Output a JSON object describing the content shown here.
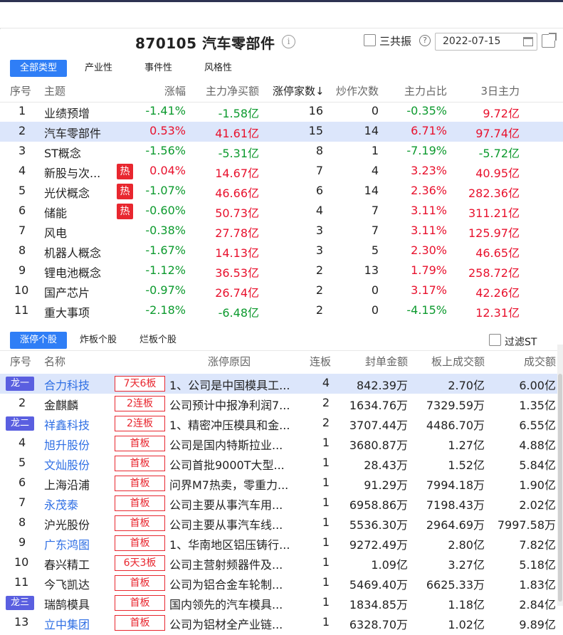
{
  "header": {
    "title": "870105 汽车零部件",
    "sangong_label": "三共振",
    "date": "2022-07-15"
  },
  "concept_tabs": [
    "全部类型",
    "产业性",
    "事件性",
    "风格性"
  ],
  "concept_columns": [
    "序号",
    "主题",
    "涨幅",
    "主力净买额",
    "涨停家数↓",
    "炒作次数",
    "主力占比",
    "3日主力"
  ],
  "concepts": [
    {
      "no": "1",
      "name": "业绩预增",
      "hot": false,
      "chg": "-1.41%",
      "net": "-1.58亿",
      "limit": "16",
      "times": "0",
      "ratio": "-0.35%",
      "d3": "9.72亿"
    },
    {
      "no": "2",
      "name": "汽车零部件",
      "hot": false,
      "chg": "0.53%",
      "net": "41.61亿",
      "limit": "15",
      "times": "14",
      "ratio": "6.71%",
      "d3": "97.74亿"
    },
    {
      "no": "3",
      "name": "ST概念",
      "hot": false,
      "chg": "-1.56%",
      "net": "-5.31亿",
      "limit": "8",
      "times": "1",
      "ratio": "-7.19%",
      "d3": "-5.72亿"
    },
    {
      "no": "4",
      "name": "新股与次...",
      "hot": true,
      "chg": "0.04%",
      "net": "14.67亿",
      "limit": "7",
      "times": "4",
      "ratio": "3.23%",
      "d3": "40.95亿"
    },
    {
      "no": "5",
      "name": "光伏概念",
      "hot": true,
      "chg": "-1.07%",
      "net": "46.66亿",
      "limit": "6",
      "times": "14",
      "ratio": "2.36%",
      "d3": "282.36亿"
    },
    {
      "no": "6",
      "name": "储能",
      "hot": true,
      "chg": "-0.60%",
      "net": "50.73亿",
      "limit": "4",
      "times": "7",
      "ratio": "3.11%",
      "d3": "311.21亿"
    },
    {
      "no": "7",
      "name": "风电",
      "hot": false,
      "chg": "-0.38%",
      "net": "27.78亿",
      "limit": "3",
      "times": "7",
      "ratio": "3.11%",
      "d3": "125.97亿"
    },
    {
      "no": "8",
      "name": "机器人概念",
      "hot": false,
      "chg": "-1.67%",
      "net": "14.13亿",
      "limit": "3",
      "times": "5",
      "ratio": "2.30%",
      "d3": "46.65亿"
    },
    {
      "no": "9",
      "name": "锂电池概念",
      "hot": false,
      "chg": "-1.12%",
      "net": "36.53亿",
      "limit": "2",
      "times": "13",
      "ratio": "1.79%",
      "d3": "258.72亿"
    },
    {
      "no": "10",
      "name": "国产芯片",
      "hot": false,
      "chg": "-0.97%",
      "net": "26.74亿",
      "limit": "2",
      "times": "0",
      "ratio": "3.17%",
      "d3": "42.26亿"
    },
    {
      "no": "11",
      "name": "重大事项",
      "hot": false,
      "chg": "-2.18%",
      "net": "-6.48亿",
      "limit": "2",
      "times": "0",
      "ratio": "-4.15%",
      "d3": "12.31亿"
    }
  ],
  "hot_label": "热",
  "stock_tabs": [
    "涨停个股",
    "炸板个股",
    "烂板个股"
  ],
  "filter_label": "过滤ST",
  "stock_columns": [
    "序号",
    "名称",
    "涨停原因",
    "连板",
    "封单金额",
    "板上成交额",
    "成交额"
  ],
  "stocks": [
    {
      "no": "",
      "dragon": "龙一",
      "name": "合力科技",
      "link": true,
      "badge": "7天6板",
      "reason": "1、公司是中国模具工...",
      "lb": "4",
      "fd": "842.39万",
      "bs": "2.70亿",
      "cj": "6.00亿"
    },
    {
      "no": "2",
      "dragon": "",
      "name": "金麒麟",
      "link": false,
      "badge": "2连板",
      "reason": "公司预计中报净利润7...",
      "lb": "2",
      "fd": "1634.76万",
      "bs": "7329.59万",
      "cj": "1.35亿"
    },
    {
      "no": "",
      "dragon": "龙二",
      "name": "祥鑫科技",
      "link": true,
      "badge": "2连板",
      "reason": "1、精密冲压模具和金...",
      "lb": "2",
      "fd": "3707.44万",
      "bs": "4486.70万",
      "cj": "6.55亿"
    },
    {
      "no": "4",
      "dragon": "",
      "name": "旭升股份",
      "link": true,
      "badge": "首板",
      "reason": "公司是国内特斯拉业...",
      "lb": "1",
      "fd": "3680.87万",
      "bs": "1.27亿",
      "cj": "4.88亿"
    },
    {
      "no": "5",
      "dragon": "",
      "name": "文灿股份",
      "link": true,
      "badge": "首板",
      "reason": "公司首批9000T大型...",
      "lb": "1",
      "fd": "28.43万",
      "bs": "1.52亿",
      "cj": "5.84亿"
    },
    {
      "no": "6",
      "dragon": "",
      "name": "上海沿浦",
      "link": false,
      "badge": "首板",
      "reason": "问界M7热卖，零重力...",
      "lb": "1",
      "fd": "91.29万",
      "bs": "7994.18万",
      "cj": "1.90亿"
    },
    {
      "no": "7",
      "dragon": "",
      "name": "永茂泰",
      "link": true,
      "badge": "首板",
      "reason": "公司主要从事汽车用...",
      "lb": "1",
      "fd": "6958.86万",
      "bs": "7198.43万",
      "cj": "2.02亿"
    },
    {
      "no": "8",
      "dragon": "",
      "name": "沪光股份",
      "link": false,
      "badge": "首板",
      "reason": "公司主要从事汽车线...",
      "lb": "1",
      "fd": "5536.30万",
      "bs": "2964.69万",
      "cj": "7997.58万"
    },
    {
      "no": "9",
      "dragon": "",
      "name": "广东鸿图",
      "link": true,
      "badge": "首板",
      "reason": "1、华南地区铝压铸行...",
      "lb": "1",
      "fd": "9272.49万",
      "bs": "2.80亿",
      "cj": "7.82亿"
    },
    {
      "no": "10",
      "dragon": "",
      "name": "春兴精工",
      "link": false,
      "badge": "6天3板",
      "reason": "公司主营射频器件及...",
      "lb": "1",
      "fd": "1.09亿",
      "bs": "3.27亿",
      "cj": "5.18亿"
    },
    {
      "no": "11",
      "dragon": "",
      "name": "今飞凯达",
      "link": false,
      "badge": "首板",
      "reason": "公司为铝合金车轮制...",
      "lb": "1",
      "fd": "5469.40万",
      "bs": "6625.33万",
      "cj": "1.83亿"
    },
    {
      "no": "",
      "dragon": "龙三",
      "name": "瑞鹄模具",
      "link": false,
      "badge": "首板",
      "reason": "国内领先的汽车模具...",
      "lb": "1",
      "fd": "1834.85万",
      "bs": "1.18亿",
      "cj": "2.84亿"
    },
    {
      "no": "13",
      "dragon": "",
      "name": "立中集团",
      "link": true,
      "badge": "首板",
      "reason": "公司为铝材全产业链...",
      "lb": "1",
      "fd": "6328.70万",
      "bs": "1.02亿",
      "cj": "9.89亿"
    }
  ],
  "colors": {
    "up": "#e8112d",
    "down": "#0c9a2e",
    "accent": "#2f7ef6",
    "selected_row": "#dce6fb",
    "dragon": "#5a5fe0",
    "link": "#2f6fe4"
  },
  "icons": [
    "info-icon",
    "help-icon",
    "calendar-icon",
    "share-icon",
    "sort-down-icon"
  ]
}
